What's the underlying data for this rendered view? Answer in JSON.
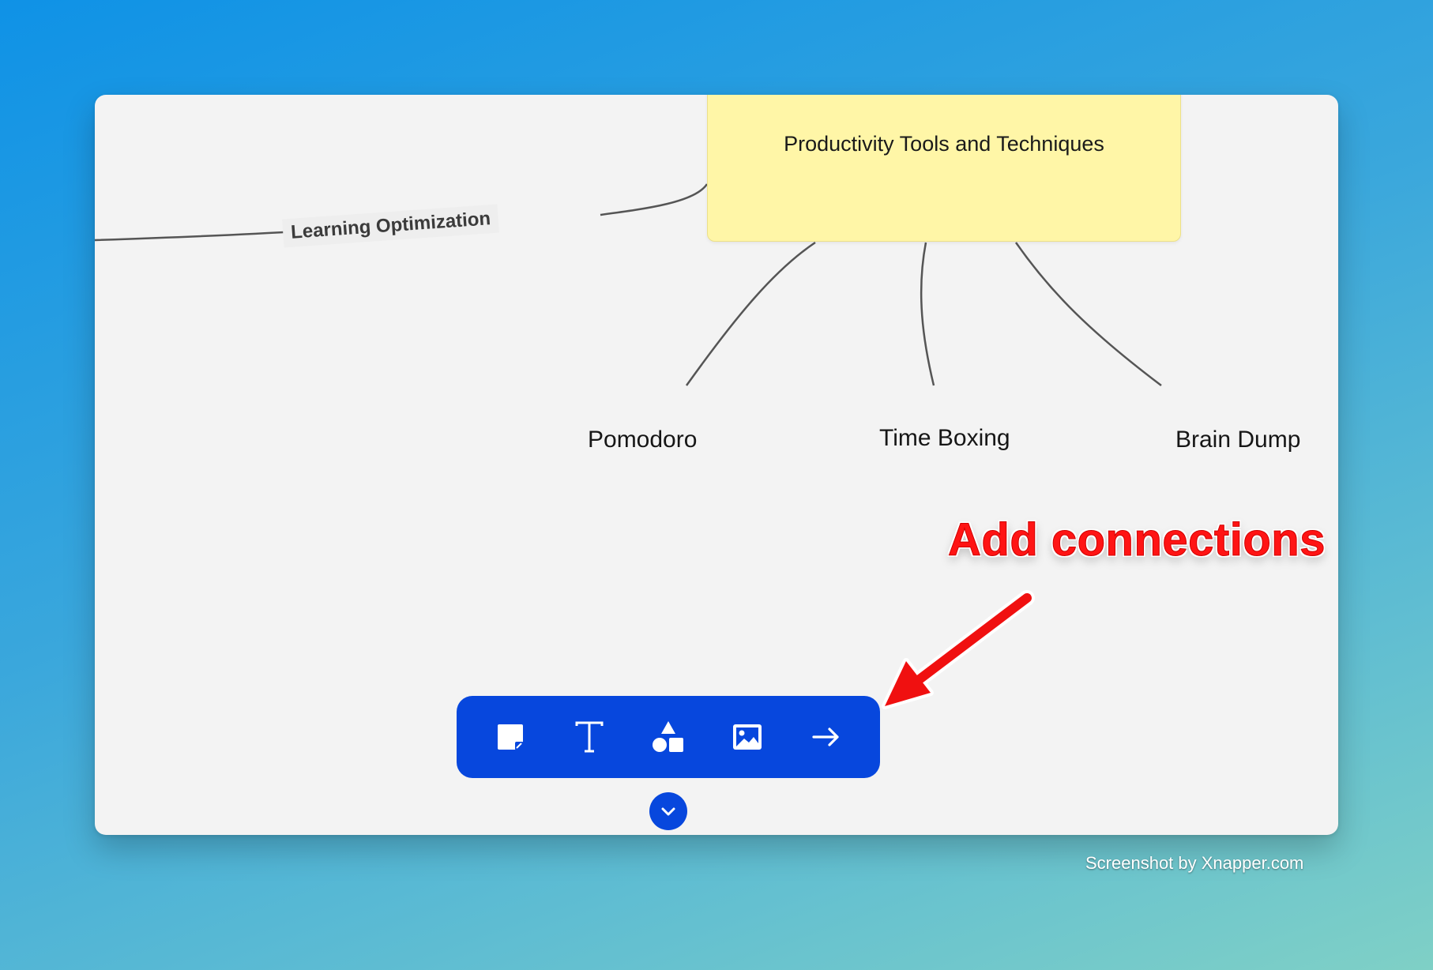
{
  "canvas": {
    "central_node": {
      "label": "Productivity Tools and Techniques",
      "color": "#fff6a7"
    },
    "edge_label": "Learning Optimization",
    "child_nodes": [
      {
        "label": "Pomodoro"
      },
      {
        "label": "Time Boxing"
      },
      {
        "label": "Brain Dump"
      }
    ]
  },
  "toolbar": {
    "color": "#0747dd",
    "tools": [
      {
        "icon": "sticky-note-icon"
      },
      {
        "icon": "text-icon"
      },
      {
        "icon": "shapes-icon"
      },
      {
        "icon": "image-icon"
      },
      {
        "icon": "connector-arrow-icon"
      }
    ],
    "collapse_icon": "chevron-down-icon"
  },
  "annotation": {
    "text": "Add connections",
    "color": "#ff1414"
  },
  "watermark": "Screenshot by Xnapper.com"
}
